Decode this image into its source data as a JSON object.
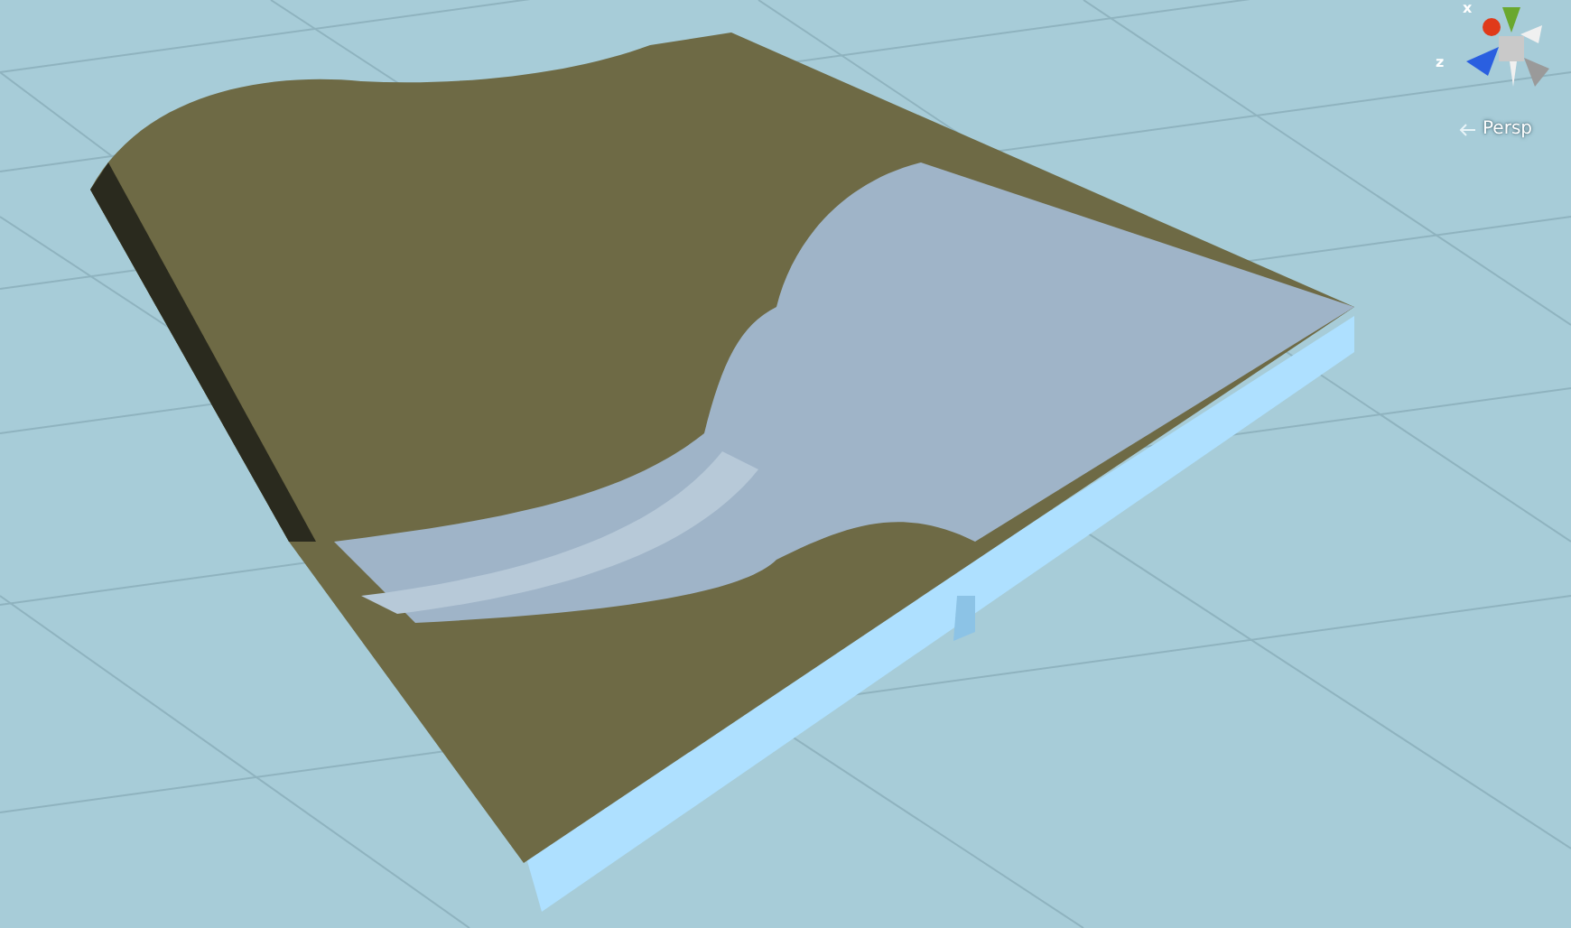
{
  "scene_gizmo": {
    "axis_labels": [
      "x",
      "z"
    ],
    "projection": "Persp"
  }
}
